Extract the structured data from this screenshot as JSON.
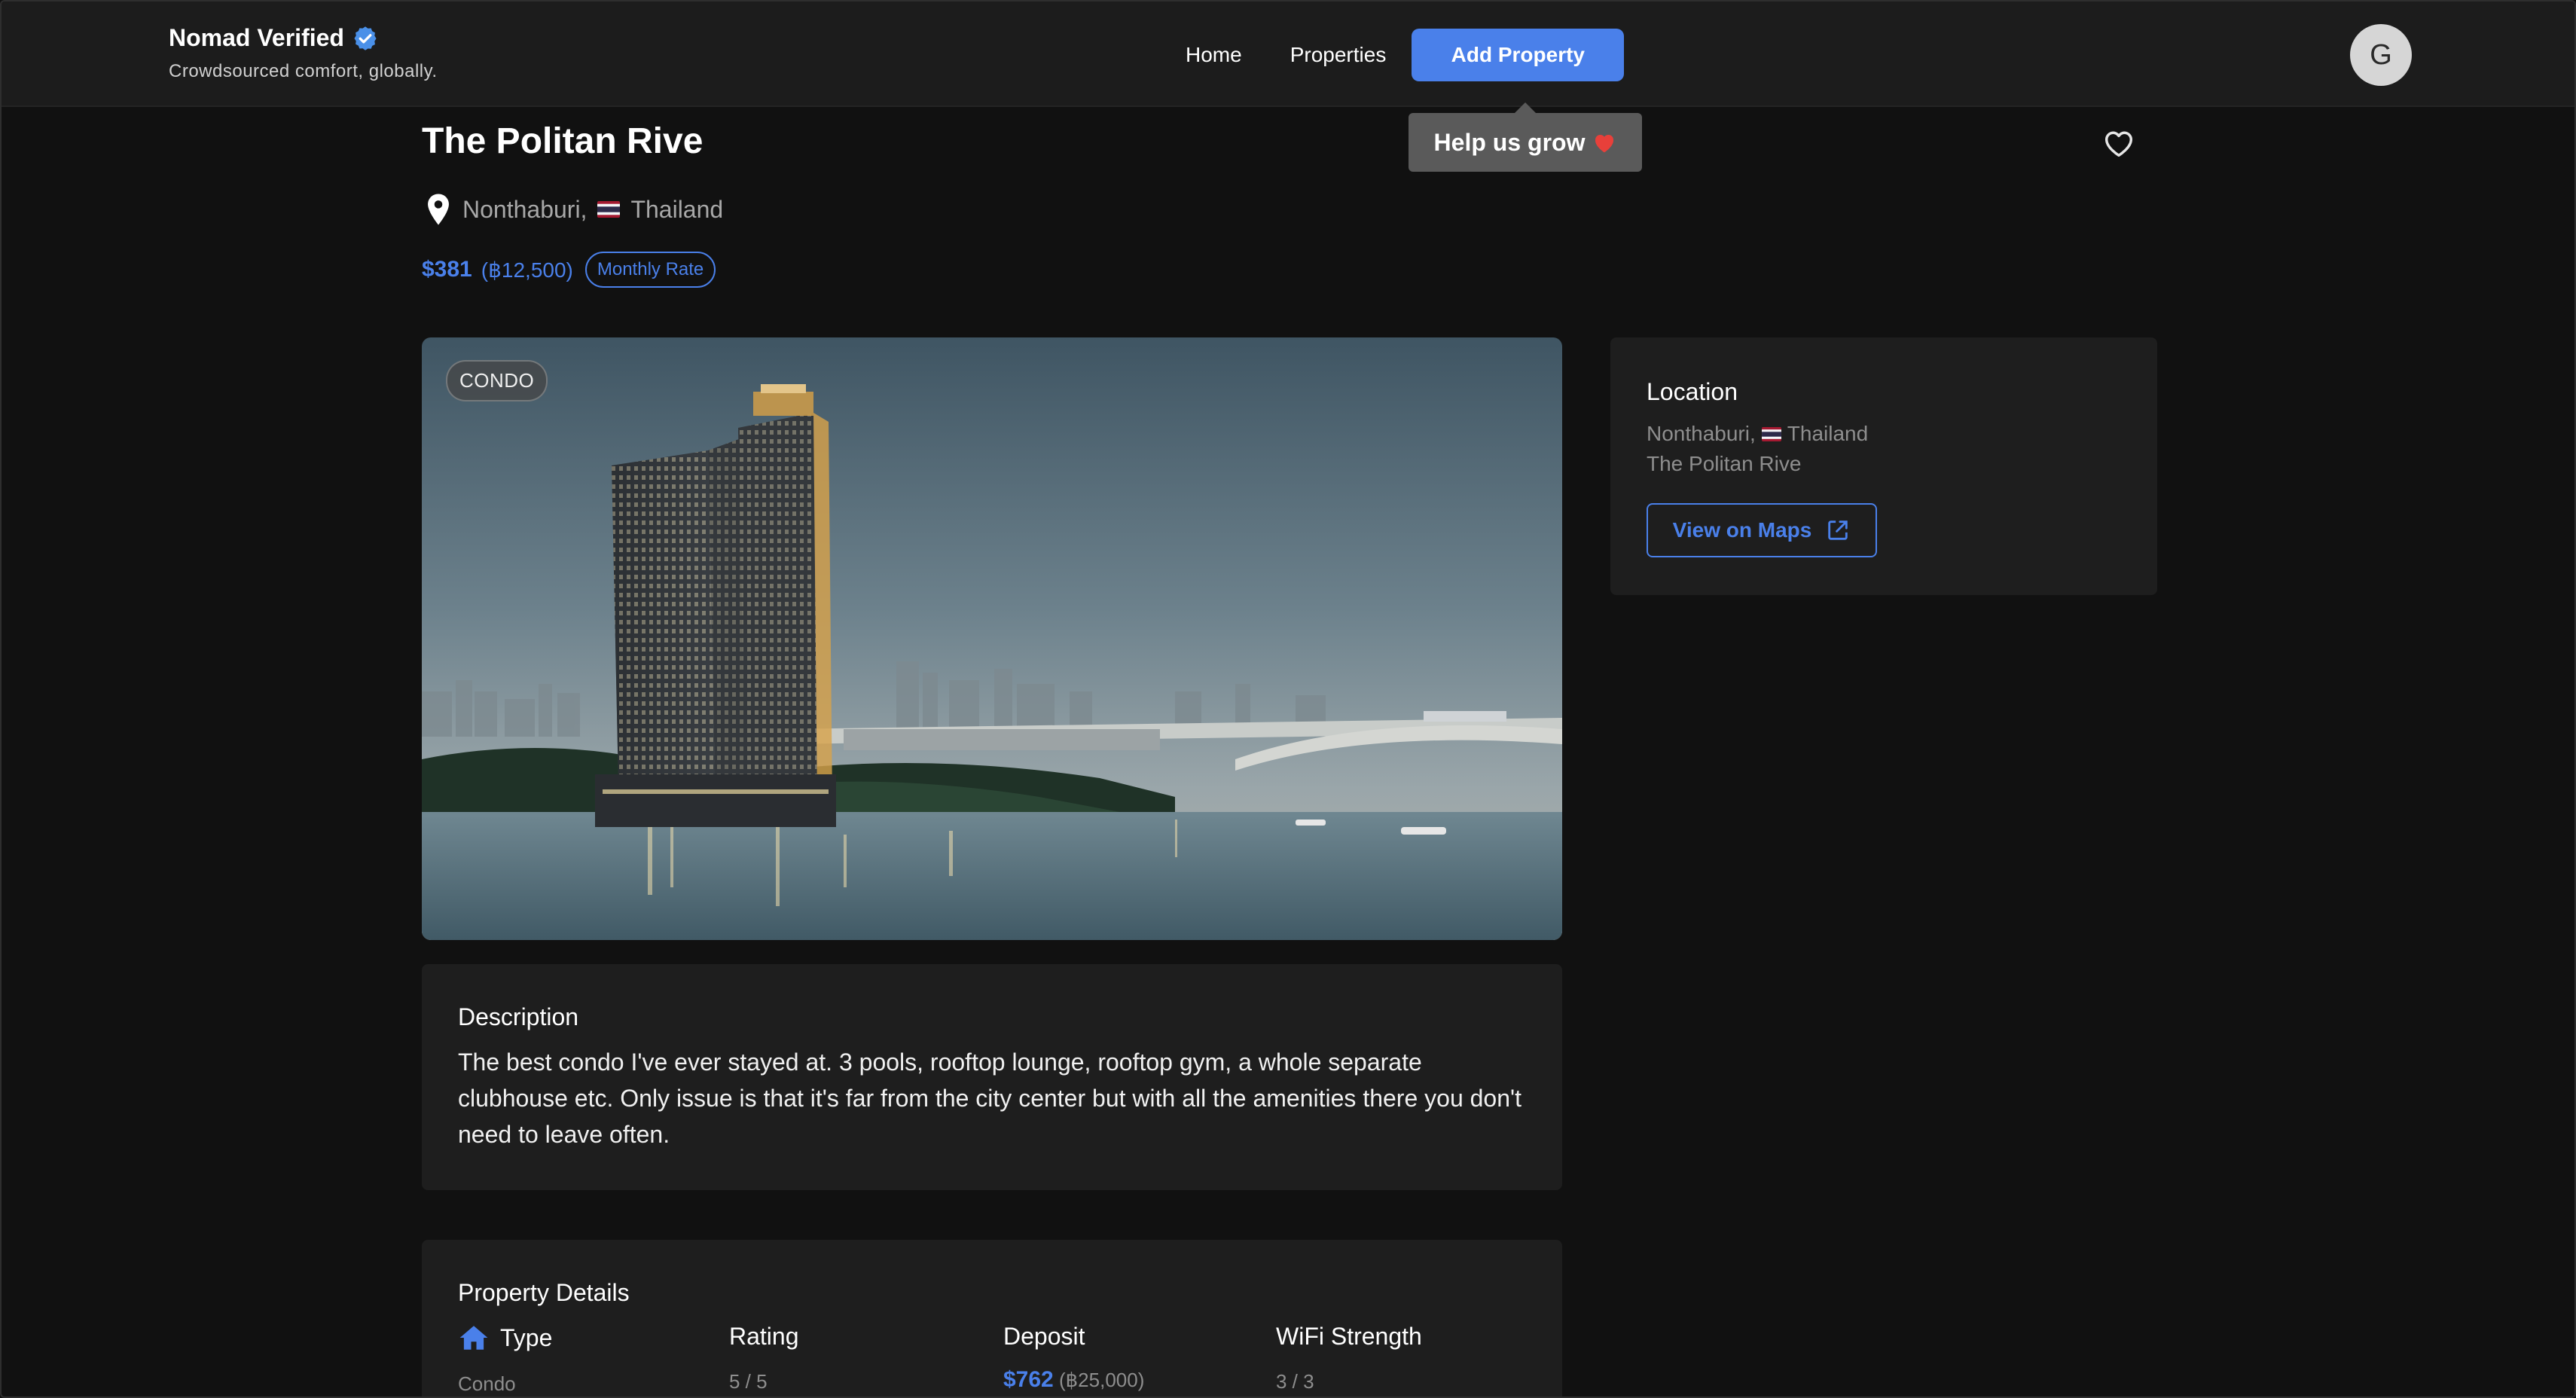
{
  "header": {
    "brand_name": "Nomad Verified",
    "tagline": "Crowdsourced comfort, globally.",
    "nav": {
      "home": "Home",
      "properties": "Properties",
      "add_property": "Add Property"
    },
    "avatar_initial": "G"
  },
  "tooltip": {
    "text": "Help us grow",
    "emoji_icon": "red-heart-icon"
  },
  "property": {
    "title": "The Politan Rive",
    "city": "Nonthaburi,",
    "country": "Thailand",
    "flag_icon": "thailand-flag-icon",
    "price_usd": "$381",
    "price_local": "(฿12,500)",
    "rate_label": "Monthly Rate",
    "type_badge": "CONDO"
  },
  "location_card": {
    "heading": "Location",
    "city": "Nonthaburi,",
    "country": "Thailand",
    "building": "The Politan Rive",
    "maps_button": "View on Maps"
  },
  "description": {
    "heading": "Description",
    "text": "The best condo I've ever stayed at. 3 pools, rooftop lounge, rooftop gym, a whole separate clubhouse etc. Only issue is that it's far from the city center but with all the amenities there you don't need to leave often."
  },
  "details": {
    "heading": "Property Details",
    "type_label": "Type",
    "type_value": "Condo",
    "rating_label": "Rating",
    "rating_value": "5 / 5",
    "deposit_label": "Deposit",
    "deposit_usd": "$762",
    "deposit_local": "(฿25,000)",
    "wifi_label": "WiFi Strength",
    "wifi_value": "3 / 3"
  },
  "colors": {
    "accent": "#4a80ea",
    "background": "#111111",
    "card": "#1e1e1e",
    "header": "#1c1c1c"
  }
}
